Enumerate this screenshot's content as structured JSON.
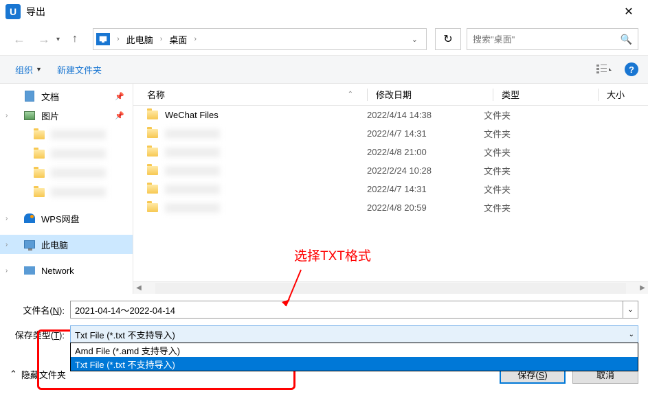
{
  "titlebar": {
    "icon_letter": "U",
    "title": "导出"
  },
  "navbar": {
    "breadcrumb": [
      "此电脑",
      "桌面"
    ],
    "search_placeholder": "搜索\"桌面\""
  },
  "toolbar": {
    "organize": "组织",
    "new_folder": "新建文件夹"
  },
  "sidebar": {
    "items": [
      {
        "label": "文档",
        "icon": "doc",
        "pinned": true
      },
      {
        "label": "图片",
        "icon": "pic",
        "pinned": true,
        "expand": true
      },
      {
        "label": "",
        "icon": "folder",
        "blur": true,
        "indent": true
      },
      {
        "label": "",
        "icon": "folder",
        "blur": true,
        "indent": true
      },
      {
        "label": "",
        "icon": "folder",
        "blur": true,
        "indent": true
      },
      {
        "label": "",
        "icon": "folder",
        "blur": true,
        "indent": true
      },
      {
        "label": "WPS网盘",
        "icon": "wps",
        "expand": true,
        "spacer_before": true
      },
      {
        "label": "此电脑",
        "icon": "pc",
        "expand": true,
        "selected": true,
        "spacer_before": true
      },
      {
        "label": "Network",
        "icon": "net",
        "expand": true,
        "spacer_before": true
      }
    ]
  },
  "columns": {
    "name": "名称",
    "date": "修改日期",
    "type": "类型",
    "size": "大小"
  },
  "files": [
    {
      "name": "WeChat Files",
      "date": "2022/4/14 14:38",
      "type": "文件夹"
    },
    {
      "name": "",
      "blur": true,
      "date": "2022/4/7 14:31",
      "type": "文件夹"
    },
    {
      "name": "",
      "blur": true,
      "date": "2022/4/8 21:00",
      "type": "文件夹"
    },
    {
      "name": "",
      "blur": true,
      "date": "2022/2/24 10:28",
      "type": "文件夹"
    },
    {
      "name": "",
      "blur": true,
      "date": "2022/4/7 14:31",
      "type": "文件夹"
    },
    {
      "name": "",
      "blur": true,
      "date": "2022/4/8 20:59",
      "type": "文件夹"
    }
  ],
  "annotation": {
    "text": "选择TXT格式"
  },
  "bottom": {
    "filename_label": "文件名(N):",
    "filename_value": "2021-04-14～2022-04-14",
    "filetype_label": "保存类型(T):",
    "filetype_selected": "Txt File (*.txt 不支持导入)",
    "filetype_options": [
      "Amd File (*.amd 支持导入)",
      "Txt File (*.txt 不支持导入)"
    ]
  },
  "footer": {
    "hide_folders": "隐藏文件夹",
    "save": "保存(S)",
    "cancel": "取消"
  }
}
